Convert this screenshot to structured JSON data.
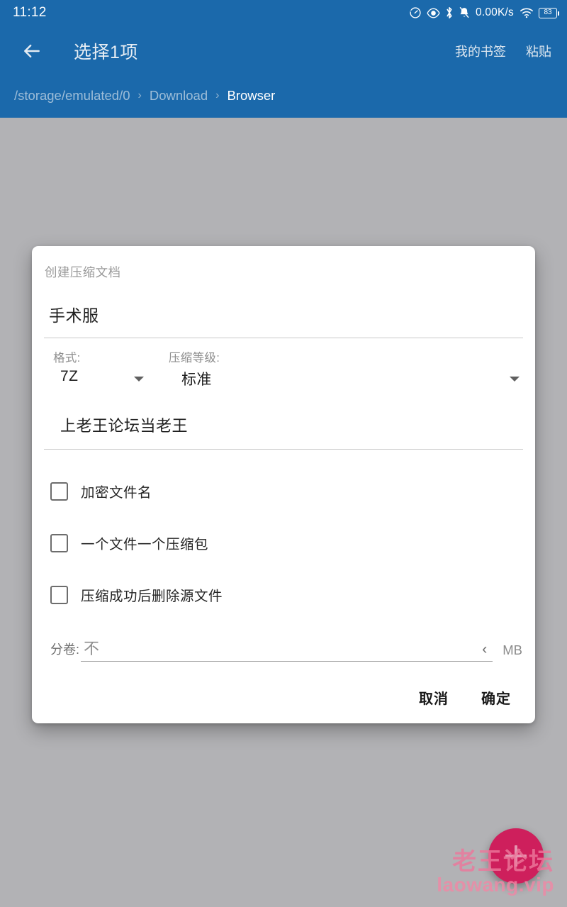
{
  "status_bar": {
    "time": "11:12",
    "network_speed": "0.00K/s",
    "battery_level": "83",
    "icons": [
      "speedometer-icon",
      "eye-icon",
      "bluetooth-icon",
      "bell-muted-icon",
      "wifi-icon",
      "battery-icon"
    ]
  },
  "app_bar": {
    "back_icon": "arrow-left-icon",
    "title": "选择1项",
    "actions": [
      {
        "label": "我的书签"
      },
      {
        "label": "粘贴"
      }
    ]
  },
  "breadcrumb": {
    "separator": "›",
    "items": [
      {
        "label": "/storage/emulated/0",
        "current": false
      },
      {
        "label": "Download",
        "current": false
      },
      {
        "label": "Browser",
        "current": true
      }
    ]
  },
  "dialog": {
    "title": "创建压缩文档",
    "archive_name": "手术服",
    "format": {
      "label": "格式:",
      "value": "7Z",
      "caret": "chevron-down-icon"
    },
    "level": {
      "label": "压缩等级:",
      "value": "标准",
      "caret": "chevron-down-icon"
    },
    "password": "上老王论坛当老王",
    "checkboxes": [
      {
        "label": "加密文件名",
        "checked": false
      },
      {
        "label": "一个文件一个压缩包",
        "checked": false
      },
      {
        "label": "压缩成功后删除源文件",
        "checked": false
      }
    ],
    "split": {
      "label": "分卷:",
      "value": "不",
      "chevron": "‹",
      "unit": "MB"
    },
    "buttons": {
      "cancel": "取消",
      "confirm": "确定"
    }
  },
  "fab": {
    "icon": "plus-icon",
    "color": "#ce1f5c"
  },
  "watermark": {
    "line1": "老王论坛",
    "line2": "laowang.vip",
    "color": "#eb789b"
  },
  "theme": {
    "primary": "#1b69ab",
    "background": "#b2b2b5",
    "dialog_background": "#ffffff"
  }
}
